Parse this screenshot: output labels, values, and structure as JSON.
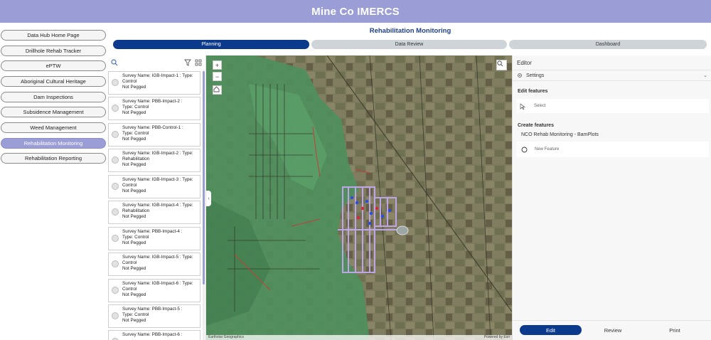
{
  "app": {
    "title": "Mine Co IMERCS"
  },
  "nav": {
    "items": [
      {
        "label": "Data Hub Home Page"
      },
      {
        "label": "Drillhole Rehab Tracker"
      },
      {
        "label": "ePTW"
      },
      {
        "label": "Aboriginal Cultural Heritage"
      },
      {
        "label": "Dam Inspections"
      },
      {
        "label": "Subsidence Management"
      },
      {
        "label": "Weed Management"
      },
      {
        "label": "Rehabilitation Monitoring",
        "active": true
      },
      {
        "label": "Rehabilitation Reporting"
      }
    ]
  },
  "page": {
    "title": "Rehabilitation Monitoring"
  },
  "tabs": [
    {
      "label": "Planning",
      "active": true
    },
    {
      "label": "Data Review"
    },
    {
      "label": "Dashboard"
    }
  ],
  "list": {
    "tools": {
      "search": "search-icon",
      "filter": "filter-icon",
      "view": "grid-view-icon"
    },
    "cards": [
      {
        "l1": "Survey Name: IGB-Impact-1 : Type:",
        "l2": "Control",
        "l3": "Not Pegged"
      },
      {
        "l1": "Survey Name: PBB-Impact-2 :",
        "l2": "Type: Control",
        "l3": "Not Pegged"
      },
      {
        "l1": "Survey Name: PBB-Control-1 :",
        "l2": "Type: Control",
        "l3": "Not Pegged"
      },
      {
        "l1": "Survey Name: IGB-Impact-2 : Type:",
        "l2": "Rehabilitation",
        "l3": "Not Pegged"
      },
      {
        "l1": "Survey Name: IGB-Impact-3 : Type:",
        "l2": "Control",
        "l3": "Not Pegged"
      },
      {
        "l1": "Survey Name: IGB-Impact-4 : Type:",
        "l2": "Rehabilitation",
        "l3": "Not Pegged"
      },
      {
        "l1": "Survey Name: PBB-Impact-4 :",
        "l2": "Type: Control",
        "l3": "Not Pegged"
      },
      {
        "l1": "Survey Name: IGB-Impact-5 : Type:",
        "l2": "Control",
        "l3": "Not Pegged"
      },
      {
        "l1": "Survey Name: IGB-Impact-6 : Type:",
        "l2": "Control",
        "l3": "Not Pegged"
      },
      {
        "l1": "Survey Name: PBB-Impact-5 :",
        "l2": "Type: Control",
        "l3": "Not Pegged"
      },
      {
        "l1": "Survey Name: PBB-Impact-6 :",
        "l2": "",
        "l3": ""
      }
    ]
  },
  "map": {
    "zoom_in": "+",
    "zoom_out": "−",
    "attribution_left": "Earthstar Geographics",
    "attribution_right": "Powered by Esri"
  },
  "editor": {
    "title": "Editor",
    "settings_label": "Settings",
    "edit_features_heading": "Edit features",
    "select_label": "Select",
    "create_features_heading": "Create features",
    "layer_name": "NCO Rehab Monitoring - BamPlots",
    "new_feature_label": "New Feature",
    "footer": {
      "edit": "Edit",
      "review": "Review",
      "print": "Print"
    }
  },
  "colors": {
    "header": "#9a9dd6",
    "accent": "#0b3a8d",
    "title": "#1e3f86"
  }
}
